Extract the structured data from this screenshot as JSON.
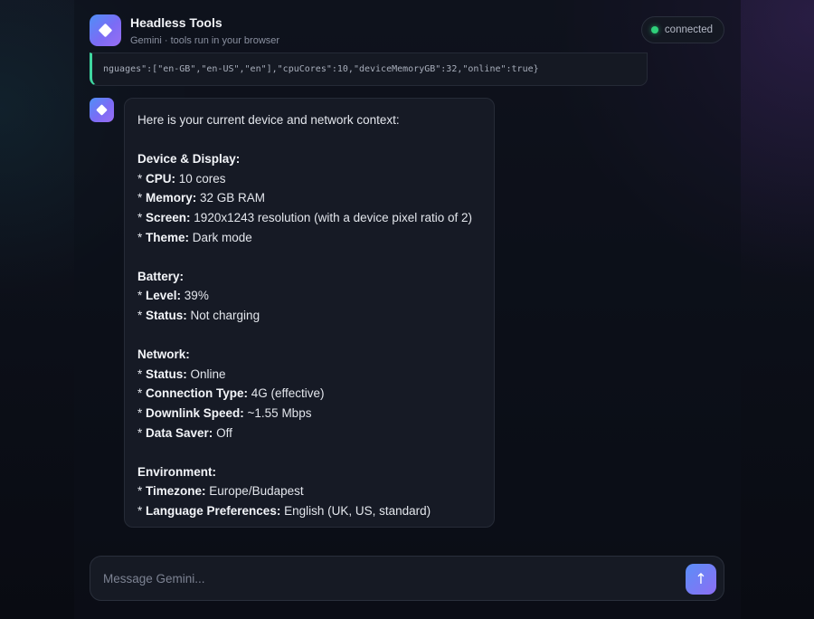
{
  "header": {
    "title": "Headless Tools",
    "subtitle": "Gemini · tools run in your browser",
    "status": "connected",
    "status_color": "#2fd07a",
    "logo_icon": "diamond-icon"
  },
  "tool_output": {
    "text": "nguages\":[\"en-GB\",\"en-US\",\"en\"],\"cpuCores\":10,\"deviceMemoryGB\":32,\"online\":true}",
    "accent_color": "#3fd6a0"
  },
  "message": {
    "intro": "Here is your current device and network context:",
    "sections": [
      {
        "title": "Device & Display:",
        "items": [
          {
            "bullet": "* ",
            "label": "CPU:",
            "value": " 10 cores"
          },
          {
            "bullet": "* ",
            "label": "Memory:",
            "value": " 32 GB RAM"
          },
          {
            "bullet": "* ",
            "label": "Screen:",
            "value": " 1920x1243 resolution (with a device pixel ratio of 2)"
          },
          {
            "bullet": "* ",
            "label": "Theme:",
            "value": " Dark mode"
          }
        ]
      },
      {
        "title": "Battery:",
        "items": [
          {
            "bullet": "* ",
            "label": "Level:",
            "value": " 39%"
          },
          {
            "bullet": "* ",
            "label": "Status:",
            "value": " Not charging"
          }
        ]
      },
      {
        "title": "Network:",
        "items": [
          {
            "bullet": "* ",
            "label": "Status:",
            "value": " Online"
          },
          {
            "bullet": "* ",
            "label": "Connection Type:",
            "value": " 4G (effective)"
          },
          {
            "bullet": "* ",
            "label": "Downlink Speed:",
            "value": " ~1.55 Mbps"
          },
          {
            "bullet": "* ",
            "label": "Data Saver:",
            "value": " Off"
          }
        ]
      },
      {
        "title": "Environment:",
        "items": [
          {
            "bullet": "* ",
            "label": "Timezone:",
            "value": " Europe/Budapest"
          },
          {
            "bullet": "* ",
            "label": "Language Preferences:",
            "value": " English (UK, US, standard)"
          }
        ]
      }
    ]
  },
  "composer": {
    "placeholder": "Message Gemini...",
    "value": "",
    "send_icon": "arrow-up-icon",
    "send_glyph": "↑"
  },
  "colors": {
    "accent_gradient_start": "#4f8ff7",
    "accent_gradient_end": "#9a6ef2",
    "background": "#0b0d14"
  }
}
